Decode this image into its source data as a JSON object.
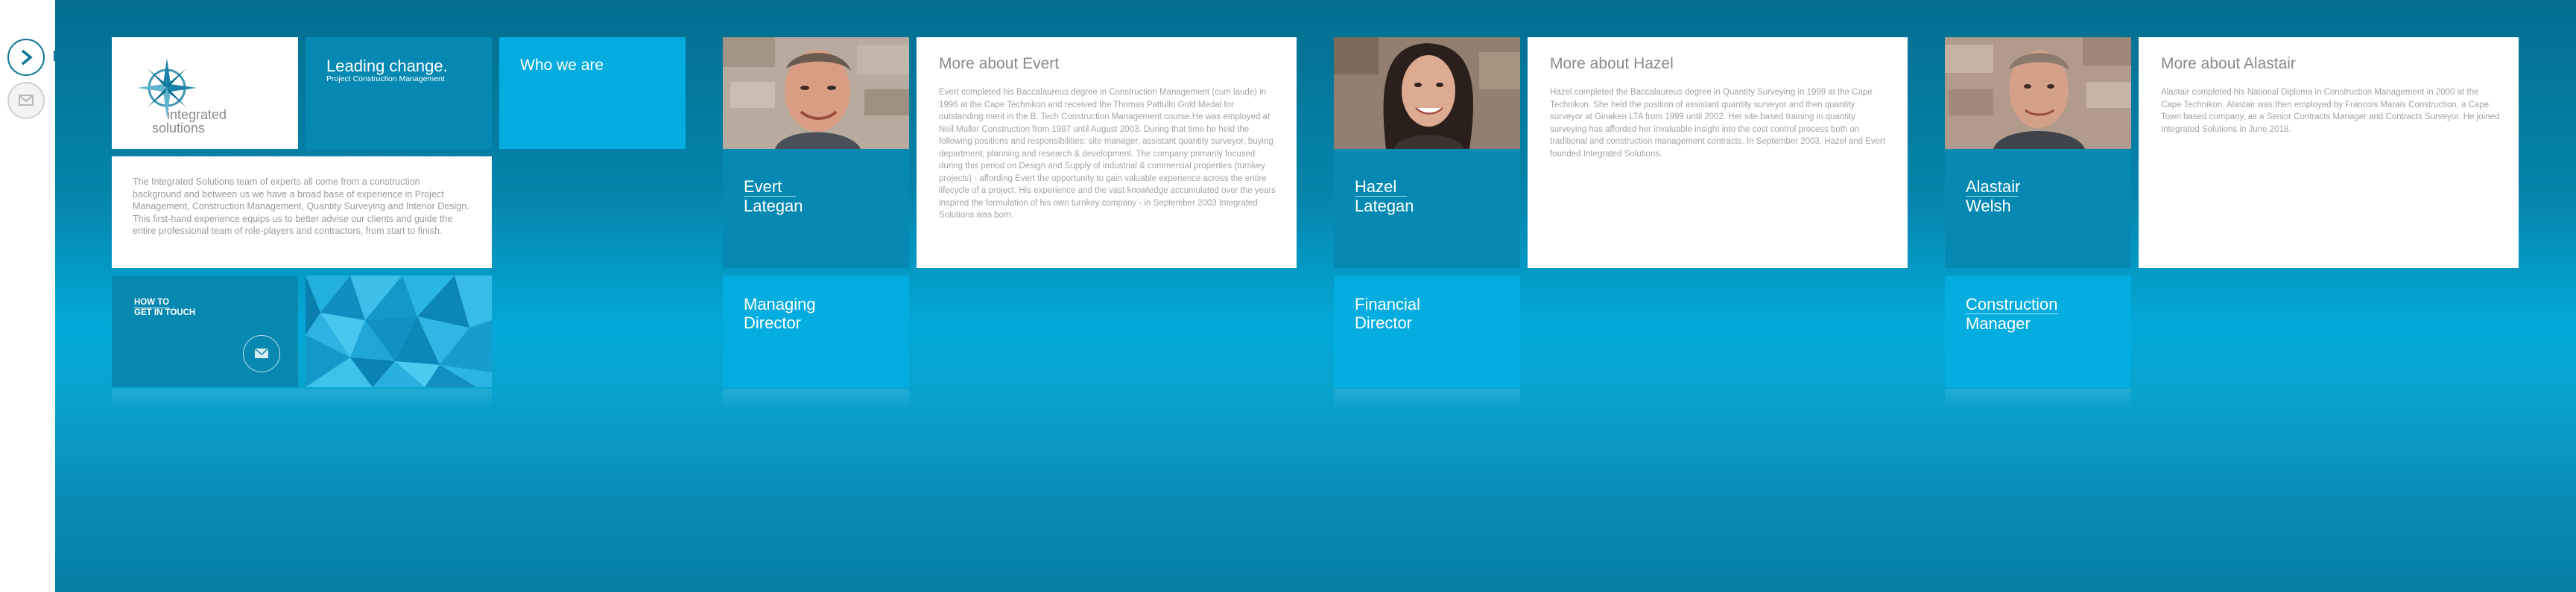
{
  "nav": {
    "next_label": ">",
    "mail_label": "✉"
  },
  "intro": {
    "brand_title": "Leading change.",
    "brand_sub": "Project Construction Management",
    "logo_word1": "integrated",
    "logo_word2": "solutions",
    "who_we_are": "Who we are",
    "about_text": "The Integrated Solutions team of experts all come from a construction background and between us we have a broad base of experience in Project Management, Construction Management, Quantity Surveying and Interior Design. This first-hand experience equips us to better advise our clients and guide the entire professional team of role-players and contractors, from start to finish.",
    "contact_line1": "HOW TO",
    "contact_line2": "GET IN TOUCH"
  },
  "people": [
    {
      "first": "Evert",
      "last": "Lategan",
      "role_line1": "Managing",
      "role_line2": "Director",
      "more_title": "More about Evert",
      "bio": "Evert completed his Baccalaureus degree in Construction Management (cum laude) in 1996 at the Cape Technikon and received the Thomas Pattullo Gold Medal for outstanding merit in the B. Tech Construction Management course.He was employed at Neil Muller Construction from 1997 until August 2003. During that time he held the following positions and responsibilities: site manager, assistant quantity surveyor, buying department, planning and research & development. The company primarily focused during this period on Design and Supply of industrial & commercial properties (turnkey projects) - affording Evert the opportunity to gain valuable experience across the entire lifecycle of a project. His experience and the vast knowledge accumulated over the years inspired the formulation of his own turnkey company - in September 2003 Integrated Solutions was born."
    },
    {
      "first": "Hazel",
      "last": "Lategan",
      "role_line1": "Financial",
      "role_line2": "Director",
      "more_title": "More about Hazel",
      "bio": "Hazel completed the Baccalaureus degree in Quantity Surveying in 1999 at the Cape Technikon. She held the position of assistant quantity surveyor and then quantity surveyor at Ginaken LTA from 1999 until 2002. Her site based training in quantity surveying has afforded her invaluable insight into the cost control process both on traditional and construction management contracts. In September 2003, Hazel and Evert founded Integrated Solutions."
    },
    {
      "first": "Alastair",
      "last": "Welsh",
      "role_line1": "Construction",
      "role_line2": "Manager",
      "more_title": "More about Alastair",
      "bio": "Alastair completed his National Diploma in Construction Management in 2000 at the Cape Technikon. Alastair was then employed by Francois Marais Construction, a Cape Town based company, as a Senior Contracts Manager and Contracts Surveyor. He joined Integrated Solutions in June 2018."
    }
  ],
  "colors": {
    "tile_dark": "#0589b3",
    "tile_light": "#03ade0",
    "background_top": "#036e90",
    "background_mid": "#03a9d8"
  }
}
